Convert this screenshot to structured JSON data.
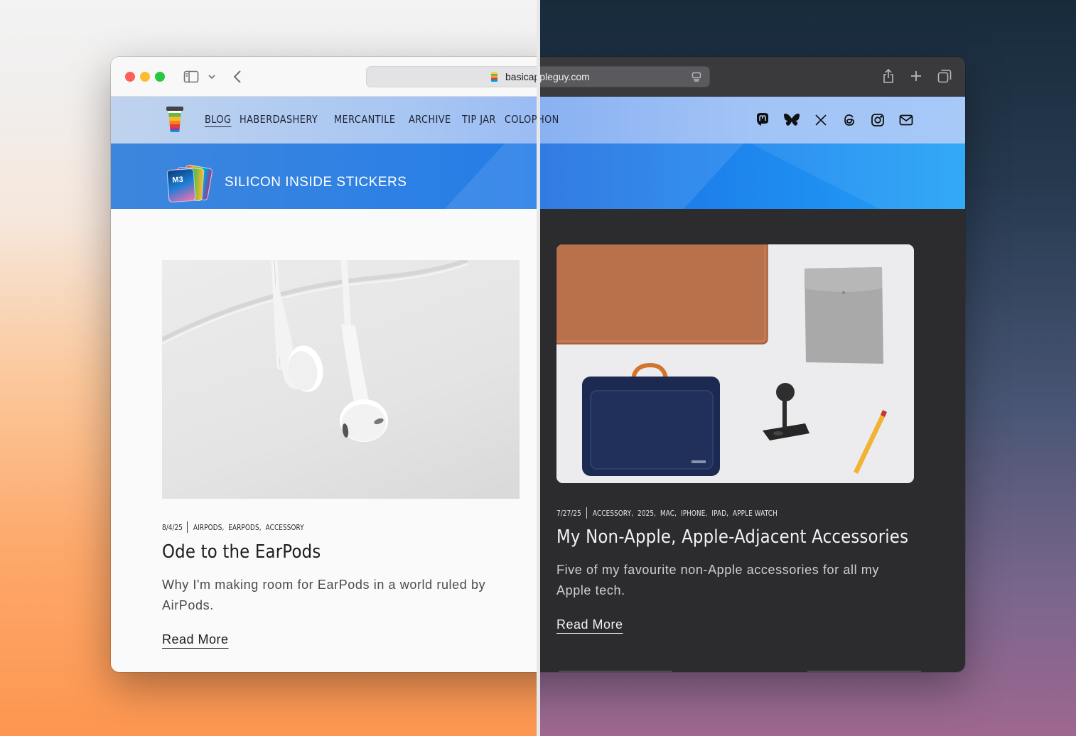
{
  "browser": {
    "url": "basicappleguy.com"
  },
  "nav": {
    "links": [
      "BLOG",
      "HABERDASHERY",
      "MERCANTILE",
      "ARCHIVE",
      "TIP JAR",
      "COLOPHON"
    ],
    "active": "BLOG",
    "social_icons": [
      "mastodon-icon",
      "bluesky-icon",
      "x-icon",
      "threads-icon",
      "instagram-icon",
      "mail-icon"
    ]
  },
  "banner": {
    "title": "SILICON INSIDE STICKERS",
    "sticker_text": "M3"
  },
  "posts": [
    {
      "date": "8/4/25",
      "tags": [
        "AIRPODS",
        "EARPODS",
        "ACCESSORY"
      ],
      "title": "Ode to the EarPods",
      "excerpt": "Why I'm making room for EarPods in a world ruled by AirPods.",
      "read_more": "Read More"
    },
    {
      "date": "7/27/25",
      "tags": [
        "ACCESSORY",
        "2025",
        "MAC",
        "IPHONE",
        "IPAD",
        "APPLE WATCH"
      ],
      "title": "My Non-Apple, Apple-Adjacent Accessories",
      "excerpt": "Five of my favourite non-Apple accessories for all my Apple tech.",
      "read_more": "Read More"
    }
  ],
  "colors": {
    "light_background": "#fafafa",
    "dark_background": "#2c2c2e",
    "banner_blue": "#1f7ae8",
    "traffic_red": "#fe5f57",
    "traffic_yellow": "#febc2e",
    "traffic_green": "#28c840"
  }
}
